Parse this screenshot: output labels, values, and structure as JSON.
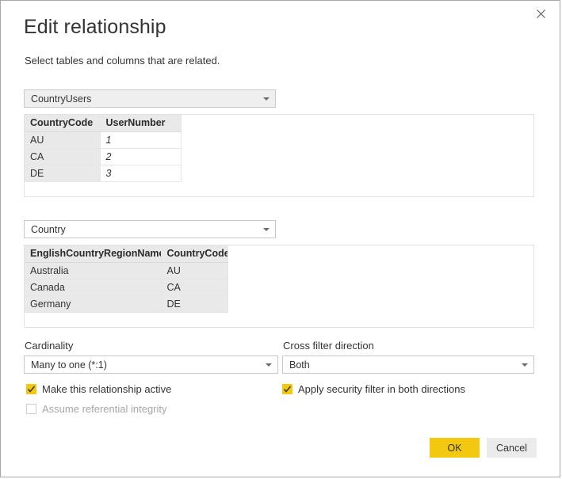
{
  "dialog": {
    "title": "Edit relationship",
    "subtitle": "Select tables and columns that are related.",
    "close_icon": "close-icon"
  },
  "accent_colors": {
    "power_bi_yellow": "#F2C811",
    "cancel_gray": "#EBEBEB",
    "grid_selected": "#E9E9E9",
    "border": "#C8C8C8"
  },
  "from_table": {
    "select_label": "CountryUsers",
    "caret_icon": "chevron-down-icon",
    "columns": [
      "CountryCode",
      "UserNumber"
    ],
    "selected_column": "CountryCode",
    "rows": [
      {
        "CountryCode": "AU",
        "UserNumber": "1"
      },
      {
        "CountryCode": "CA",
        "UserNumber": "2"
      },
      {
        "CountryCode": "DE",
        "UserNumber": "3"
      }
    ]
  },
  "to_table": {
    "select_label": "Country",
    "caret_icon": "chevron-down-icon",
    "columns": [
      "EnglishCountryRegionName",
      "CountryCode"
    ],
    "selected_column": "CountryCode",
    "rows": [
      {
        "EnglishCountryRegionName": "Australia",
        "CountryCode": "AU"
      },
      {
        "EnglishCountryRegionName": "Canada",
        "CountryCode": "CA"
      },
      {
        "EnglishCountryRegionName": "Germany",
        "CountryCode": "DE"
      }
    ]
  },
  "cardinality": {
    "label": "Cardinality",
    "value": "Many to one (*:1)",
    "caret_icon": "chevron-down-icon"
  },
  "cross_filter": {
    "label": "Cross filter direction",
    "value": "Both",
    "caret_icon": "chevron-down-icon"
  },
  "options": {
    "make_active": {
      "label": "Make this relationship active",
      "checked": true,
      "enabled": true
    },
    "referential_integrity": {
      "label": "Assume referential integrity",
      "checked": false,
      "enabled": false
    },
    "security_filter": {
      "label": "Apply security filter in both directions",
      "checked": true,
      "enabled": true
    }
  },
  "footer": {
    "ok_label": "OK",
    "cancel_label": "Cancel"
  }
}
